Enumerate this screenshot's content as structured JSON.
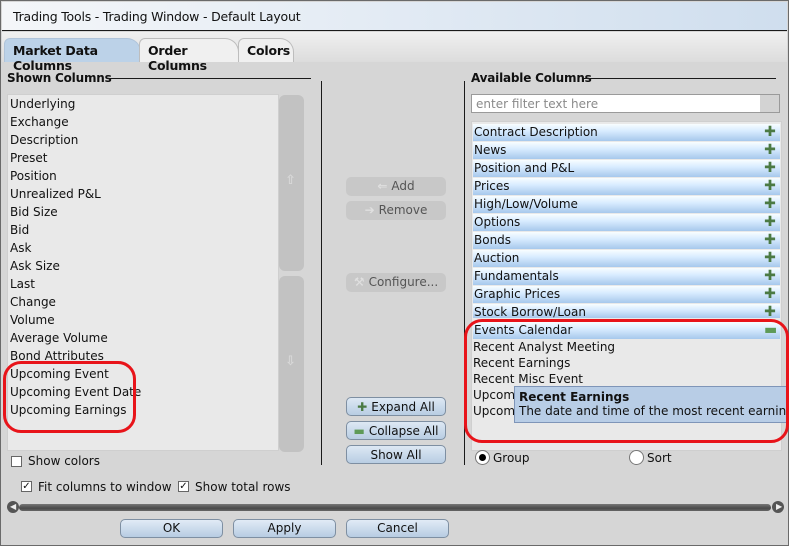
{
  "window": {
    "title": "Trading Tools - Trading Window - Default Layout"
  },
  "tabs": [
    {
      "label": "Market Data Columns",
      "active": true
    },
    {
      "label": "Order Columns",
      "active": false
    },
    {
      "label": "Colors",
      "active": false
    }
  ],
  "shown_columns": {
    "title": "Shown Columns",
    "items": [
      "Underlying",
      "Exchange",
      "Description",
      "Preset",
      "Position",
      "Unrealized P&L",
      "Bid Size",
      "Bid",
      "Ask",
      "Ask Size",
      "Last",
      "Change",
      "Volume",
      "Average Volume",
      "Bond Attributes",
      "Upcoming Event",
      "Upcoming Event Date",
      "Upcoming Earnings"
    ],
    "show_colors": {
      "label": "Show colors",
      "checked": false
    },
    "move_up_icon": "arrow-up-icon",
    "move_down_icon": "arrow-down-icon"
  },
  "middle_buttons": {
    "add": {
      "label": "Add",
      "icon": "arrow-left-icon",
      "enabled": false
    },
    "remove": {
      "label": "Remove",
      "icon": "arrow-right-icon",
      "enabled": false
    },
    "configure": {
      "label": "Configure...",
      "icon": "wrench-icon",
      "enabled": false
    },
    "expand_all": {
      "label": "Expand All",
      "icon": "plus-icon"
    },
    "collapse_all": {
      "label": "Collapse All",
      "icon": "minus-icon"
    },
    "show_all": {
      "label": "Show All"
    }
  },
  "available_columns": {
    "title": "Available Columns",
    "filter_placeholder": "enter filter text here",
    "filter_value": "",
    "groups": [
      {
        "label": "Contract Description",
        "expanded": false
      },
      {
        "label": "News",
        "expanded": false
      },
      {
        "label": "Position and P&L",
        "expanded": false
      },
      {
        "label": "Prices",
        "expanded": false
      },
      {
        "label": "High/Low/Volume",
        "expanded": false
      },
      {
        "label": "Options",
        "expanded": false
      },
      {
        "label": "Bonds",
        "expanded": false
      },
      {
        "label": "Auction",
        "expanded": false
      },
      {
        "label": "Fundamentals",
        "expanded": false
      },
      {
        "label": "Graphic Prices",
        "expanded": false
      },
      {
        "label": "Stock Borrow/Loan",
        "expanded": false
      },
      {
        "label": "Events Calendar",
        "expanded": true
      }
    ],
    "events_calendar_children": [
      "Recent Analyst Meeting",
      "Recent Earnings",
      "Recent Misc Event",
      "Upcomi",
      "Upcomi"
    ],
    "view_mode": {
      "group": {
        "label": "Group",
        "selected": true
      },
      "sort": {
        "label": "Sort",
        "selected": false
      }
    }
  },
  "tooltip": {
    "title": "Recent Earnings",
    "description": "The date and time of the most recent earnings/ea"
  },
  "options": {
    "fit_columns": {
      "label": "Fit columns to window",
      "checked": true
    },
    "show_total_rows": {
      "label": "Show total rows",
      "checked": true
    }
  },
  "dialog_buttons": {
    "ok": "OK",
    "apply": "Apply",
    "cancel": "Cancel"
  },
  "colors": {
    "highlight": "#e8141a",
    "active_tab": "#bcd2e8",
    "tooltip_bg": "#b8cde6"
  }
}
